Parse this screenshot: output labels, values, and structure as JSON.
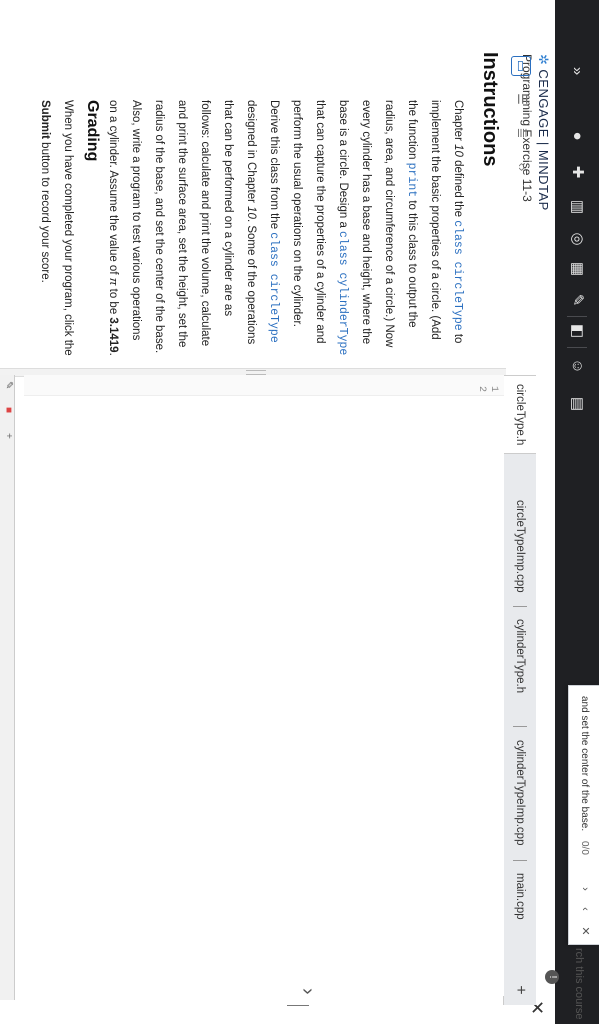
{
  "browser": {
    "icons": [
      "expand-chevrons-icon",
      "record-dot-icon",
      "extension-icon",
      "library-icon",
      "compass-icon",
      "calendar-icon",
      "translate-icon",
      "screenshot-icon",
      "profile-icon",
      "reader-icon"
    ]
  },
  "header": {
    "brand_left": "CENGAGE",
    "brand_separator": "|",
    "brand_right": "MINDTAP",
    "subtitle": "Programming Exercise 11-3",
    "search_text": "rch this course"
  },
  "find_bar": {
    "text": "and set the center of the base.",
    "count": "0/0"
  },
  "instructions": {
    "title": "Instructions",
    "body_segments": {
      "p1": "Chapter ",
      "p1_chapter": "10",
      "p2": " defined the ",
      "code1": "class circleType",
      "p3": " to implement the basic properties of a circle. (Add the function ",
      "code2": "print",
      "p4": " to this class to output the radius, area, and circumference of a circle.) Now every cylinder has a base and height, where the base is a circle. Design a ",
      "code3": "class cylinderType",
      "p5": " that can capture the properties of a cylinder and perform the usual operations on the cylinder. Derive this class from the ",
      "code4": "class circleType",
      "p6": " designed in Chapter ",
      "p6_chapter": "10",
      "p7": ". Some of the operations that can be performed on a cylinder are as follows: calculate and print the volume, calculate and print the surface area, set the height, set the radius of the base, and set the center of the base. Also, write a program to test various operations on a cylinder. Assume the value of ",
      "pi": "π",
      "p8": " to be ",
      "pi_value": "3.1419",
      "p9": "."
    },
    "grading_title": "Grading",
    "grading_p1": "When you have completed your program, click the ",
    "grading_bold": "Submit",
    "grading_p2": " button to record your score."
  },
  "editor": {
    "tabs": [
      "circleType.h",
      "circleTypeImp.cpp",
      "cylinderType.h",
      "cylinderTypeImp.cpp",
      "main.cpp"
    ],
    "active_tab": "circleType.h",
    "add_tab": "+",
    "line_numbers": [
      "1",
      "2"
    ]
  }
}
